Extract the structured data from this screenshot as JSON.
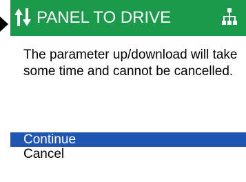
{
  "colors": {
    "title_bar": "#1b9a4b",
    "selection": "#1f56b3",
    "title_text": "#ffffff"
  },
  "header": {
    "icon": "transfer-arrows-icon",
    "title": "PANEL TO DRIVE",
    "status_icon": "network-icon"
  },
  "dialog": {
    "message": "The parameter up/download will take some time and cannot be cancelled."
  },
  "menu": {
    "selected_index": 0,
    "items": [
      {
        "label": "Continue"
      },
      {
        "label": "Cancel"
      }
    ]
  }
}
